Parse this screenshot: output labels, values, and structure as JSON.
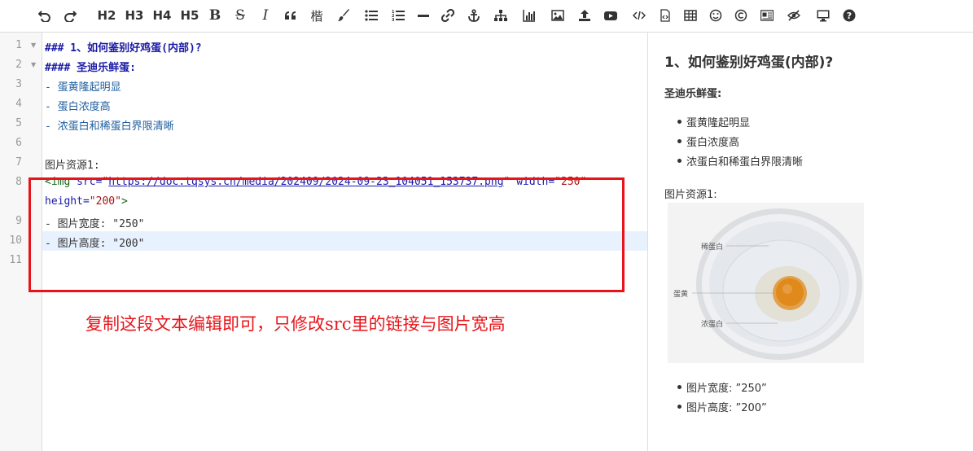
{
  "toolbar": {
    "items": [
      {
        "name": "undo-icon"
      },
      {
        "name": "redo-icon"
      },
      {
        "name": "h2-button",
        "label": "H2"
      },
      {
        "name": "h3-button",
        "label": "H3"
      },
      {
        "name": "h4-button",
        "label": "H4"
      },
      {
        "name": "h5-button",
        "label": "H5"
      },
      {
        "name": "bold-icon",
        "label": "B"
      },
      {
        "name": "strikethrough-icon",
        "label": "S"
      },
      {
        "name": "italic-icon",
        "label": "I"
      },
      {
        "name": "quote-icon"
      },
      {
        "name": "font-icon",
        "label": "楷"
      },
      {
        "name": "brush-icon"
      },
      {
        "name": "unordered-list-icon"
      },
      {
        "name": "ordered-list-icon"
      },
      {
        "name": "horizontal-rule-icon"
      },
      {
        "name": "link-icon"
      },
      {
        "name": "anchor-icon"
      },
      {
        "name": "sitemap-icon"
      },
      {
        "name": "bar-chart-icon"
      },
      {
        "name": "image-icon"
      },
      {
        "name": "upload-icon"
      },
      {
        "name": "video-icon"
      },
      {
        "name": "code-icon"
      },
      {
        "name": "code-file-icon"
      },
      {
        "name": "table-icon"
      },
      {
        "name": "emoji-icon"
      },
      {
        "name": "copyright-icon"
      },
      {
        "name": "html-entity-icon"
      },
      {
        "name": "clear-format-icon"
      },
      {
        "name": "preview-icon"
      },
      {
        "name": "help-icon"
      }
    ]
  },
  "editor": {
    "line_numbers": [
      "1",
      "2",
      "3",
      "4",
      "5",
      "6",
      "7",
      "8",
      "",
      "9",
      "10",
      "11"
    ],
    "lines": {
      "l1": "### 1、如何鉴别好鸡蛋(内部)?",
      "l2": "#### 圣迪乐鲜蛋:",
      "l3": "- 蛋黄隆起明显",
      "l4": "- 蛋白浓度高",
      "l5": "- 浓蛋白和稀蛋白界限清晰",
      "l7": "图片资源1:",
      "l8_tag": "<img",
      "l8_src_attr": " src=",
      "l8_q1": "\"",
      "l8_url": "https://doc.tqsys.cn/media/202409/2024-09-23_104051_153737.png",
      "l8_q2": "\"",
      "l8_width_attr": " width=",
      "l8_width_val": "\"250\"",
      "l8b_height_attr": "height=",
      "l8b_height_val": "\"200\"",
      "l8b_close": ">",
      "l9": "- 图片宽度: \"250\"",
      "l10": "- 图片高度: \"200\""
    },
    "annotation": "复制这段文本编辑即可，只修改src里的链接与图片宽高"
  },
  "preview": {
    "h3": "1、如何鉴别好鸡蛋(内部)?",
    "h4": "圣迪乐鲜蛋:",
    "list1": [
      "蛋黄隆起明显",
      "蛋白浓度高",
      "浓蛋白和稀蛋白界限清晰"
    ],
    "image_caption": "图片资源1:",
    "image_labels": {
      "thin": "稀蛋白",
      "yolk": "蛋黄",
      "thick": "浓蛋白"
    },
    "list2": [
      "图片宽度: ”250”",
      "图片高度: ”200”"
    ]
  },
  "colors": {
    "accent_red": "#e8141a",
    "header_blue": "#1a1aa6"
  }
}
